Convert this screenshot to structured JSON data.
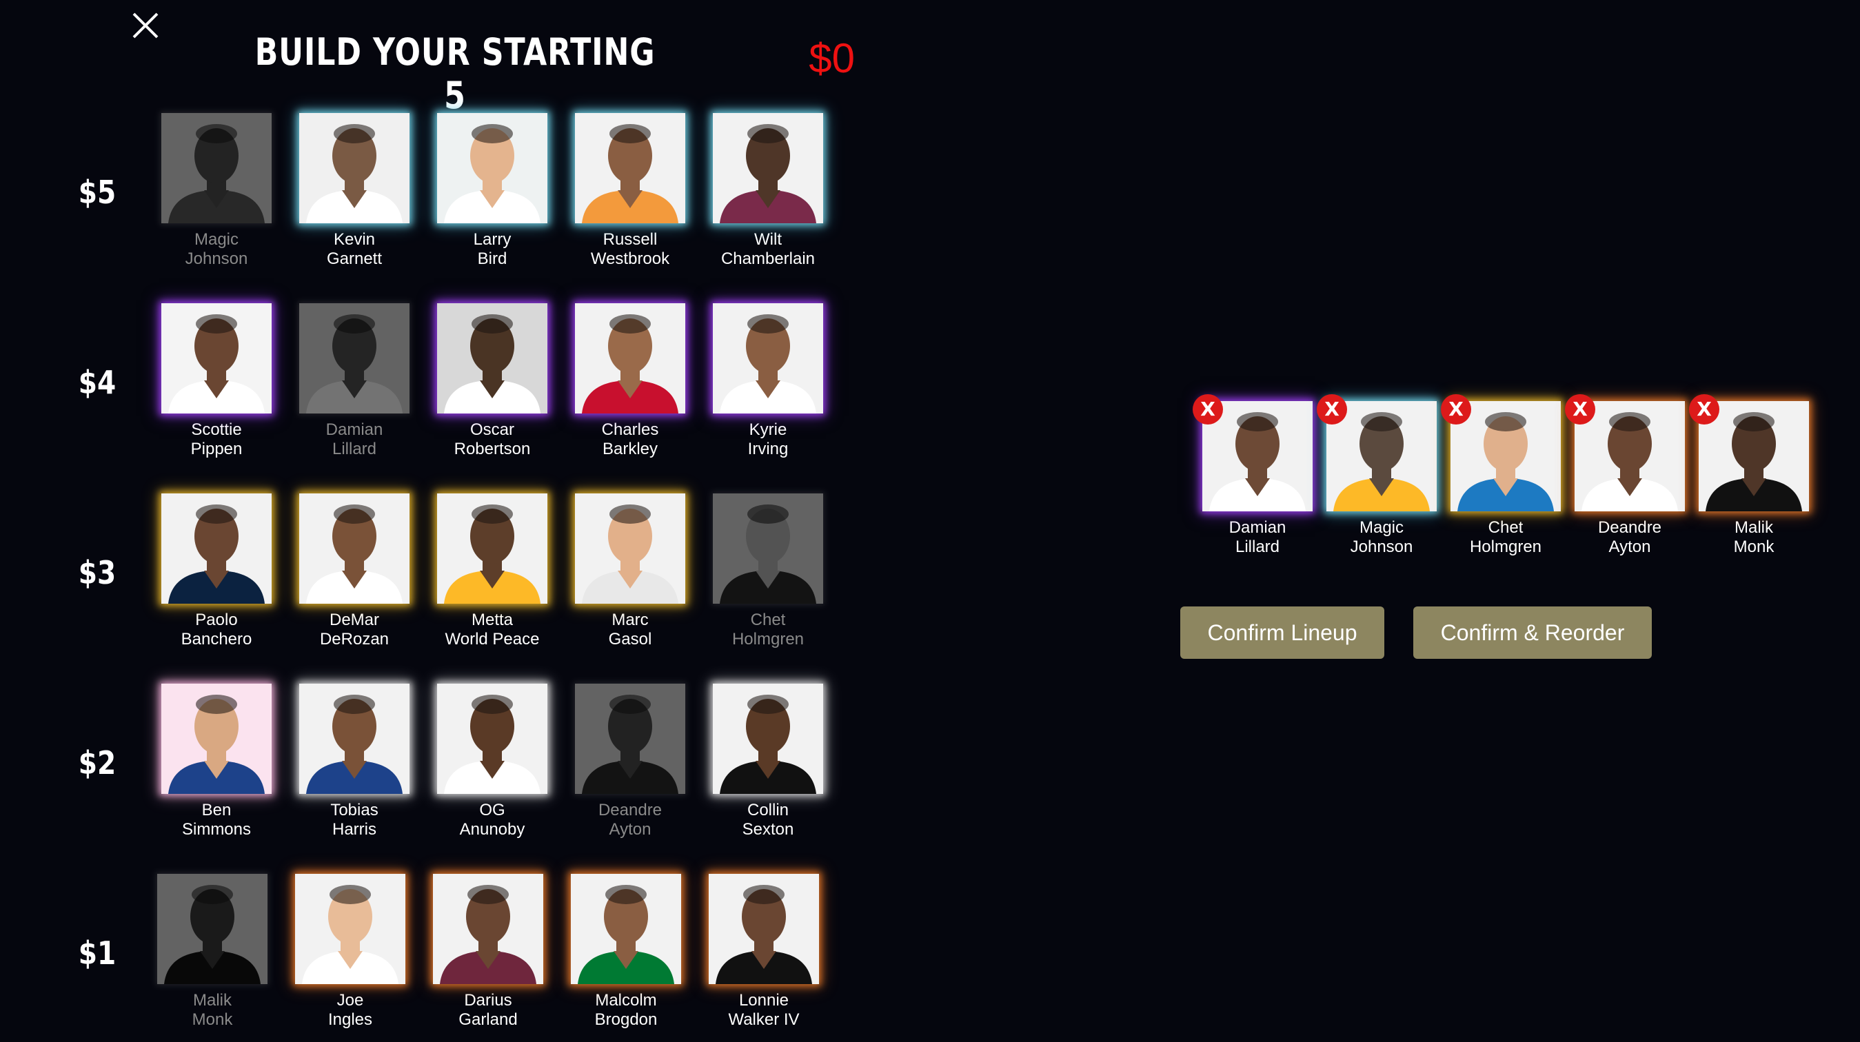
{
  "header": {
    "title": "BUILD YOUR STARTING 5",
    "budget": "$0"
  },
  "colors": {
    "budget": "#ee1111",
    "button_bg": "#8d8660",
    "remove_badge": "#dd1a1a"
  },
  "icons": {
    "close": "close-icon",
    "remove": "remove-x-badge"
  },
  "tiers": [
    {
      "label": "$5",
      "players": [
        {
          "first": "Magic",
          "last": "Johnson",
          "status": "selected"
        },
        {
          "first": "Kevin",
          "last": "Garnett"
        },
        {
          "first": "Larry",
          "last": "Bird"
        },
        {
          "first": "Russell",
          "last": "Westbrook"
        },
        {
          "first": "Wilt",
          "last": "Chamberlain"
        }
      ]
    },
    {
      "label": "$4",
      "players": [
        {
          "first": "Scottie",
          "last": "Pippen"
        },
        {
          "first": "Damian",
          "last": "Lillard",
          "status": "selected"
        },
        {
          "first": "Oscar",
          "last": "Robertson"
        },
        {
          "first": "Charles",
          "last": "Barkley"
        },
        {
          "first": "Kyrie",
          "last": "Irving"
        }
      ]
    },
    {
      "label": "$3",
      "players": [
        {
          "first": "Paolo",
          "last": "Banchero"
        },
        {
          "first": "DeMar",
          "last": "DeRozan"
        },
        {
          "first": "Metta",
          "last": "World Peace"
        },
        {
          "first": "Marc",
          "last": "Gasol"
        },
        {
          "first": "Chet",
          "last": "Holmgren",
          "status": "selected"
        }
      ]
    },
    {
      "label": "$2",
      "players": [
        {
          "first": "Ben",
          "last": "Simmons"
        },
        {
          "first": "Tobias",
          "last": "Harris"
        },
        {
          "first": "OG",
          "last": "Anunoby"
        },
        {
          "first": "Deandre",
          "last": "Ayton",
          "status": "selected"
        },
        {
          "first": "Collin",
          "last": "Sexton"
        }
      ]
    },
    {
      "label": "$1",
      "players": [
        {
          "first": "Malik",
          "last": "Monk",
          "status": "selected"
        },
        {
          "first": "Joe",
          "last": "Ingles"
        },
        {
          "first": "Darius",
          "last": "Garland"
        },
        {
          "first": "Malcolm",
          "last": "Brogdon"
        },
        {
          "first": "Lonnie",
          "last": "Walker IV"
        }
      ]
    }
  ],
  "lineup": [
    {
      "first": "Damian",
      "last": "Lillard",
      "remove_label": "X"
    },
    {
      "first": "Magic",
      "last": "Johnson",
      "remove_label": "X"
    },
    {
      "first": "Chet",
      "last": "Holmgren",
      "remove_label": "X"
    },
    {
      "first": "Deandre",
      "last": "Ayton",
      "remove_label": "X"
    },
    {
      "first": "Malik",
      "last": "Monk",
      "remove_label": "X"
    }
  ],
  "actions": {
    "confirm_lineup": "Confirm Lineup",
    "confirm_reorder": "Confirm & Reorder"
  }
}
